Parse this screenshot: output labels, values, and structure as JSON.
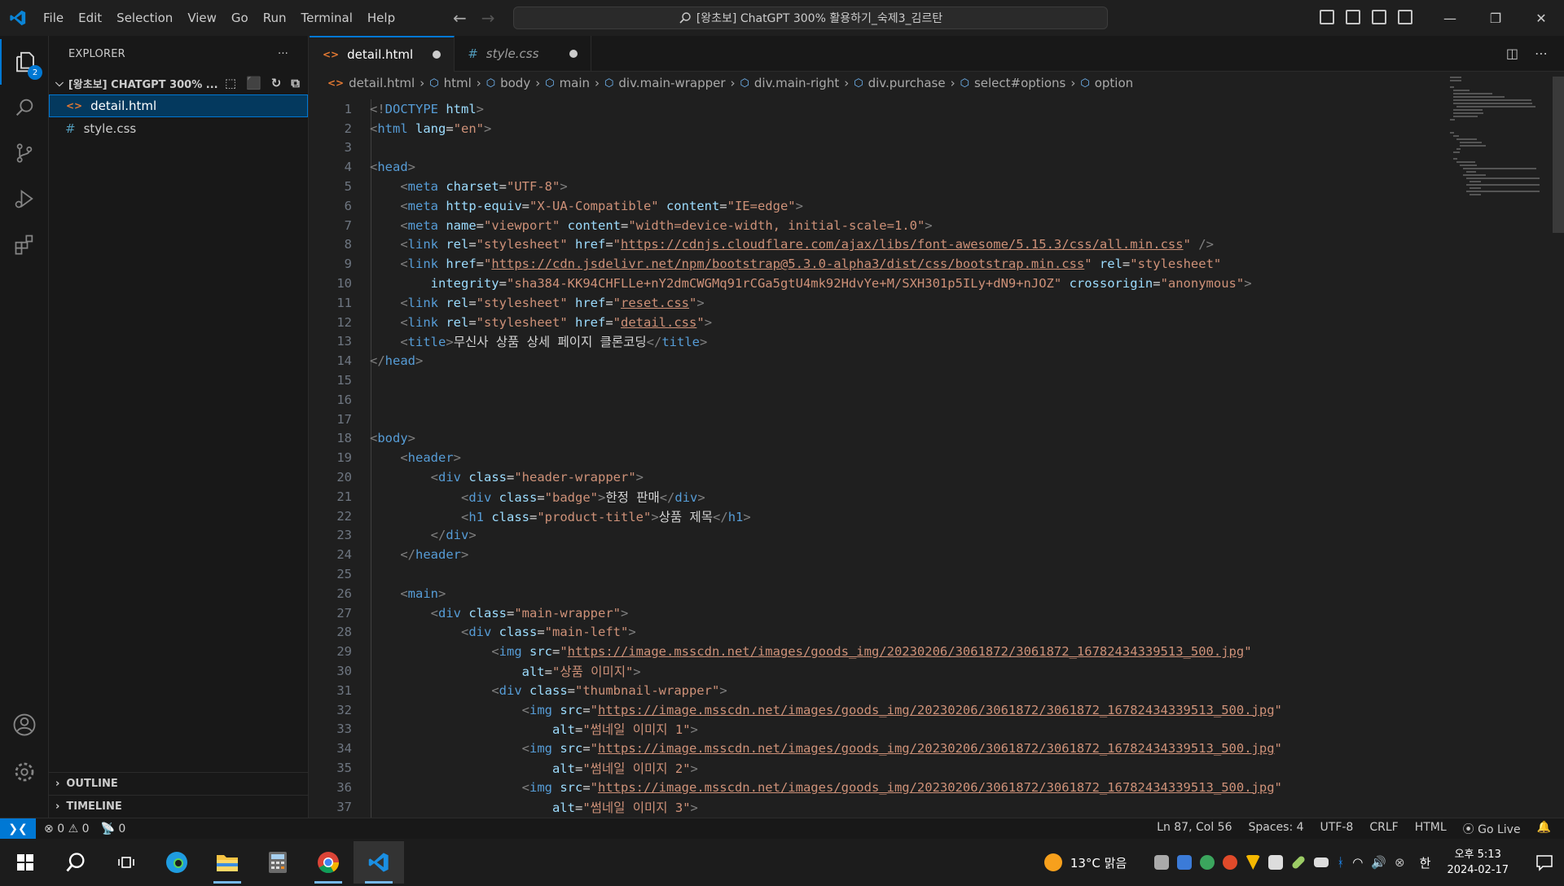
{
  "menu": [
    "File",
    "Edit",
    "Selection",
    "View",
    "Go",
    "Run",
    "Terminal",
    "Help"
  ],
  "title": "[왕초보] ChatGPT 300% 활용하기_숙제3_김르탄",
  "explorer": {
    "label": "EXPLORER",
    "more": "···",
    "folder": "[왕초보] CHATGPT 300% ...",
    "files": [
      {
        "name": "detail.html",
        "icon": "<>"
      },
      {
        "name": "style.css",
        "icon": "#"
      }
    ],
    "outline": "OUTLINE",
    "timeline": "TIMELINE",
    "source_control_badge": "2"
  },
  "tabs": [
    {
      "label": "detail.html",
      "icon": "<>"
    },
    {
      "label": "style.css",
      "icon": "#"
    }
  ],
  "breadcrumb": [
    "detail.html",
    "html",
    "body",
    "main",
    "div.main-wrapper",
    "div.main-right",
    "div.purchase",
    "select#options",
    "option"
  ],
  "code_lines": [
    {
      "n": "1",
      "i": 0,
      "s": [
        [
          "b",
          "<!"
        ],
        [
          "g",
          "DOCTYPE"
        ],
        [
          "a",
          " html"
        ],
        [
          "b",
          ">"
        ]
      ]
    },
    {
      "n": "2",
      "i": 0,
      "s": [
        [
          "b",
          "<"
        ],
        [
          "g",
          "html"
        ],
        [
          "a",
          " lang"
        ],
        [
          "t",
          "="
        ],
        [
          "s",
          "\"en\""
        ],
        [
          "b",
          ">"
        ]
      ]
    },
    {
      "n": "3",
      "i": 0,
      "s": []
    },
    {
      "n": "4",
      "i": 0,
      "s": [
        [
          "b",
          "<"
        ],
        [
          "g",
          "head"
        ],
        [
          "b",
          ">"
        ]
      ]
    },
    {
      "n": "5",
      "i": 1,
      "s": [
        [
          "b",
          "<"
        ],
        [
          "g",
          "meta"
        ],
        [
          "a",
          " charset"
        ],
        [
          "t",
          "="
        ],
        [
          "s",
          "\"UTF-8\""
        ],
        [
          "b",
          ">"
        ]
      ]
    },
    {
      "n": "6",
      "i": 1,
      "s": [
        [
          "b",
          "<"
        ],
        [
          "g",
          "meta"
        ],
        [
          "a",
          " http-equiv"
        ],
        [
          "t",
          "="
        ],
        [
          "s",
          "\"X-UA-Compatible\""
        ],
        [
          "a",
          " content"
        ],
        [
          "t",
          "="
        ],
        [
          "s",
          "\"IE=edge\""
        ],
        [
          "b",
          ">"
        ]
      ]
    },
    {
      "n": "7",
      "i": 1,
      "s": [
        [
          "b",
          "<"
        ],
        [
          "g",
          "meta"
        ],
        [
          "a",
          " name"
        ],
        [
          "t",
          "="
        ],
        [
          "s",
          "\"viewport\""
        ],
        [
          "a",
          " content"
        ],
        [
          "t",
          "="
        ],
        [
          "s",
          "\"width=device-width, initial-scale=1.0\""
        ],
        [
          "b",
          ">"
        ]
      ]
    },
    {
      "n": "8",
      "i": 1,
      "s": [
        [
          "b",
          "<"
        ],
        [
          "g",
          "link"
        ],
        [
          "a",
          " rel"
        ],
        [
          "t",
          "="
        ],
        [
          "s",
          "\"stylesheet\""
        ],
        [
          "a",
          " href"
        ],
        [
          "t",
          "="
        ],
        [
          "s",
          "\""
        ],
        [
          "u",
          "https://cdnjs.cloudflare.com/ajax/libs/font-awesome/5.15.3/css/all.min.css"
        ],
        [
          "s",
          "\""
        ],
        [
          "b",
          " />"
        ]
      ]
    },
    {
      "n": "9",
      "i": 1,
      "s": [
        [
          "b",
          "<"
        ],
        [
          "g",
          "link"
        ],
        [
          "a",
          " href"
        ],
        [
          "t",
          "="
        ],
        [
          "s",
          "\""
        ],
        [
          "u",
          "https://cdn.jsdelivr.net/npm/bootstrap@5.3.0-alpha3/dist/css/bootstrap.min.css"
        ],
        [
          "s",
          "\""
        ],
        [
          "a",
          " rel"
        ],
        [
          "t",
          "="
        ],
        [
          "s",
          "\"stylesheet\""
        ]
      ]
    },
    {
      "n": "10",
      "i": 2,
      "s": [
        [
          "a",
          "integrity"
        ],
        [
          "t",
          "="
        ],
        [
          "s",
          "\"sha384-KK94CHFLLe+nY2dmCWGMq91rCGa5gtU4mk92HdvYe+M/SXH301p5ILy+dN9+nJOZ\""
        ],
        [
          "a",
          " crossorigin"
        ],
        [
          "t",
          "="
        ],
        [
          "s",
          "\"anonymous\""
        ],
        [
          "b",
          ">"
        ]
      ]
    },
    {
      "n": "11",
      "i": 1,
      "s": [
        [
          "b",
          "<"
        ],
        [
          "g",
          "link"
        ],
        [
          "a",
          " rel"
        ],
        [
          "t",
          "="
        ],
        [
          "s",
          "\"stylesheet\""
        ],
        [
          "a",
          " href"
        ],
        [
          "t",
          "="
        ],
        [
          "s",
          "\""
        ],
        [
          "u",
          "reset.css"
        ],
        [
          "s",
          "\""
        ],
        [
          "b",
          ">"
        ]
      ]
    },
    {
      "n": "12",
      "i": 1,
      "s": [
        [
          "b",
          "<"
        ],
        [
          "g",
          "link"
        ],
        [
          "a",
          " rel"
        ],
        [
          "t",
          "="
        ],
        [
          "s",
          "\"stylesheet\""
        ],
        [
          "a",
          " href"
        ],
        [
          "t",
          "="
        ],
        [
          "s",
          "\""
        ],
        [
          "u",
          "detail.css"
        ],
        [
          "s",
          "\""
        ],
        [
          "b",
          ">"
        ]
      ]
    },
    {
      "n": "13",
      "i": 1,
      "s": [
        [
          "b",
          "<"
        ],
        [
          "g",
          "title"
        ],
        [
          "b",
          ">"
        ],
        [
          "t",
          "무신사 상품 상세 페이지 클론코딩"
        ],
        [
          "b",
          "</"
        ],
        [
          "g",
          "title"
        ],
        [
          "b",
          ">"
        ]
      ]
    },
    {
      "n": "14",
      "i": 0,
      "s": [
        [
          "b",
          "</"
        ],
        [
          "g",
          "head"
        ],
        [
          "b",
          ">"
        ]
      ]
    },
    {
      "n": "15",
      "i": 0,
      "s": []
    },
    {
      "n": "16",
      "i": 0,
      "s": []
    },
    {
      "n": "17",
      "i": 0,
      "s": []
    },
    {
      "n": "18",
      "i": 0,
      "s": [
        [
          "b",
          "<"
        ],
        [
          "g",
          "body"
        ],
        [
          "b",
          ">"
        ]
      ]
    },
    {
      "n": "19",
      "i": 1,
      "s": [
        [
          "b",
          "<"
        ],
        [
          "g",
          "header"
        ],
        [
          "b",
          ">"
        ]
      ]
    },
    {
      "n": "20",
      "i": 2,
      "s": [
        [
          "b",
          "<"
        ],
        [
          "g",
          "div"
        ],
        [
          "a",
          " class"
        ],
        [
          "t",
          "="
        ],
        [
          "s",
          "\"header-wrapper\""
        ],
        [
          "b",
          ">"
        ]
      ]
    },
    {
      "n": "21",
      "i": 3,
      "s": [
        [
          "b",
          "<"
        ],
        [
          "g",
          "div"
        ],
        [
          "a",
          " class"
        ],
        [
          "t",
          "="
        ],
        [
          "s",
          "\"badge\""
        ],
        [
          "b",
          ">"
        ],
        [
          "t",
          "한정 판매"
        ],
        [
          "b",
          "</"
        ],
        [
          "g",
          "div"
        ],
        [
          "b",
          ">"
        ]
      ]
    },
    {
      "n": "22",
      "i": 3,
      "s": [
        [
          "b",
          "<"
        ],
        [
          "g",
          "h1"
        ],
        [
          "a",
          " class"
        ],
        [
          "t",
          "="
        ],
        [
          "s",
          "\"product-title\""
        ],
        [
          "b",
          ">"
        ],
        [
          "t",
          "상품 제목"
        ],
        [
          "b",
          "</"
        ],
        [
          "g",
          "h1"
        ],
        [
          "b",
          ">"
        ]
      ]
    },
    {
      "n": "23",
      "i": 2,
      "s": [
        [
          "b",
          "</"
        ],
        [
          "g",
          "div"
        ],
        [
          "b",
          ">"
        ]
      ]
    },
    {
      "n": "24",
      "i": 1,
      "s": [
        [
          "b",
          "</"
        ],
        [
          "g",
          "header"
        ],
        [
          "b",
          ">"
        ]
      ]
    },
    {
      "n": "25",
      "i": 0,
      "s": []
    },
    {
      "n": "26",
      "i": 1,
      "s": [
        [
          "b",
          "<"
        ],
        [
          "g",
          "main"
        ],
        [
          "b",
          ">"
        ]
      ]
    },
    {
      "n": "27",
      "i": 2,
      "s": [
        [
          "b",
          "<"
        ],
        [
          "g",
          "div"
        ],
        [
          "a",
          " class"
        ],
        [
          "t",
          "="
        ],
        [
          "s",
          "\"main-wrapper\""
        ],
        [
          "b",
          ">"
        ]
      ]
    },
    {
      "n": "28",
      "i": 3,
      "s": [
        [
          "b",
          "<"
        ],
        [
          "g",
          "div"
        ],
        [
          "a",
          " class"
        ],
        [
          "t",
          "="
        ],
        [
          "s",
          "\"main-left\""
        ],
        [
          "b",
          ">"
        ]
      ]
    },
    {
      "n": "29",
      "i": 4,
      "s": [
        [
          "b",
          "<"
        ],
        [
          "g",
          "img"
        ],
        [
          "a",
          " src"
        ],
        [
          "t",
          "="
        ],
        [
          "s",
          "\""
        ],
        [
          "u",
          "https://image.msscdn.net/images/goods_img/20230206/3061872/3061872_16782434339513_500.jpg"
        ],
        [
          "s",
          "\""
        ]
      ]
    },
    {
      "n": "30",
      "i": 5,
      "s": [
        [
          "a",
          "alt"
        ],
        [
          "t",
          "="
        ],
        [
          "s",
          "\"상품 이미지\""
        ],
        [
          "b",
          ">"
        ]
      ]
    },
    {
      "n": "31",
      "i": 4,
      "s": [
        [
          "b",
          "<"
        ],
        [
          "g",
          "div"
        ],
        [
          "a",
          " class"
        ],
        [
          "t",
          "="
        ],
        [
          "s",
          "\"thumbnail-wrapper\""
        ],
        [
          "b",
          ">"
        ]
      ]
    },
    {
      "n": "32",
      "i": 5,
      "s": [
        [
          "b",
          "<"
        ],
        [
          "g",
          "img"
        ],
        [
          "a",
          " src"
        ],
        [
          "t",
          "="
        ],
        [
          "s",
          "\""
        ],
        [
          "u",
          "https://image.msscdn.net/images/goods_img/20230206/3061872/3061872_16782434339513_500.jpg"
        ],
        [
          "s",
          "\""
        ]
      ]
    },
    {
      "n": "33",
      "i": 6,
      "s": [
        [
          "a",
          "alt"
        ],
        [
          "t",
          "="
        ],
        [
          "s",
          "\"썸네일 이미지 1\""
        ],
        [
          "b",
          ">"
        ]
      ]
    },
    {
      "n": "34",
      "i": 5,
      "s": [
        [
          "b",
          "<"
        ],
        [
          "g",
          "img"
        ],
        [
          "a",
          " src"
        ],
        [
          "t",
          "="
        ],
        [
          "s",
          "\""
        ],
        [
          "u",
          "https://image.msscdn.net/images/goods_img/20230206/3061872/3061872_16782434339513_500.jpg"
        ],
        [
          "s",
          "\""
        ]
      ]
    },
    {
      "n": "35",
      "i": 6,
      "s": [
        [
          "a",
          "alt"
        ],
        [
          "t",
          "="
        ],
        [
          "s",
          "\"썸네일 이미지 2\""
        ],
        [
          "b",
          ">"
        ]
      ]
    },
    {
      "n": "36",
      "i": 5,
      "s": [
        [
          "b",
          "<"
        ],
        [
          "g",
          "img"
        ],
        [
          "a",
          " src"
        ],
        [
          "t",
          "="
        ],
        [
          "s",
          "\""
        ],
        [
          "u",
          "https://image.msscdn.net/images/goods_img/20230206/3061872/3061872_16782434339513_500.jpg"
        ],
        [
          "s",
          "\""
        ]
      ]
    },
    {
      "n": "37",
      "i": 6,
      "s": [
        [
          "a",
          "alt"
        ],
        [
          "t",
          "="
        ],
        [
          "s",
          "\"썸네일 이미지 3\""
        ],
        [
          "b",
          ">"
        ]
      ]
    }
  ],
  "status": {
    "errors": "0",
    "warnings": "0",
    "ports": "0",
    "position": "Ln 87, Col 56",
    "spaces": "Spaces: 4",
    "encoding": "UTF-8",
    "eol": "CRLF",
    "language": "HTML",
    "golive": "Go Live"
  },
  "taskbar": {
    "weather": "13°C 맑음",
    "ime": "한",
    "time": "오후 5:13",
    "date": "2024-02-17"
  },
  "colors": {
    "accent": "#0078d4",
    "tag": "#569cd6",
    "attr": "#9cdcfe",
    "string": "#ce9178"
  }
}
